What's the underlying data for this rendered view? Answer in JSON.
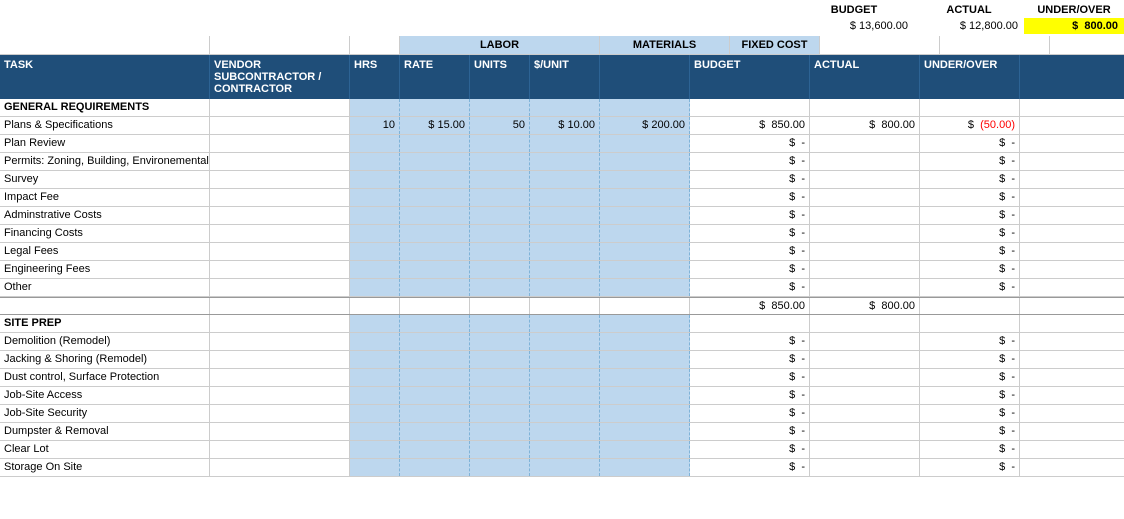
{
  "summary": {
    "budget_label": "BUDGET",
    "actual_label": "ACTUAL",
    "underover_label": "UNDER/OVER",
    "budget_value": "$ 13,600.00",
    "actual_value": "$ 12,800.00",
    "underover_value": "800.00"
  },
  "col_groups": {
    "labor_label": "LABOR",
    "materials_label": "MATERIALS",
    "fixed_cost_label": "FIXED COST"
  },
  "headers": {
    "task": "TASK",
    "vendor": "VENDOR\nSUBCONTRACTOR /\nCONTRACTOR",
    "hrs": "HRS",
    "rate": "RATE",
    "units": "UNITS",
    "sunit": "$/UNIT",
    "fixed": "",
    "budget": "BUDGET",
    "actual": "ACTUAL",
    "underover": "UNDER/OVER"
  },
  "sections": [
    {
      "name": "GENERAL REQUIREMENTS",
      "rows": [
        {
          "task": "Plans & Specifications",
          "vendor": "",
          "hrs": "10",
          "rate": "$ 15.00",
          "units": "50",
          "sunit": "$ 10.00",
          "fixed": "$ 200.00",
          "budget_dollar": "$",
          "budget_val": "850.00",
          "actual_dollar": "$",
          "actual_val": "800.00",
          "under_dollar": "$",
          "under_val": "(50.00)",
          "under_neg": true
        },
        {
          "task": "Plan Review",
          "vendor": "",
          "hrs": "",
          "rate": "",
          "units": "",
          "sunit": "",
          "fixed": "",
          "budget_dollar": "$",
          "budget_val": "-",
          "actual_dollar": "",
          "actual_val": "",
          "under_dollar": "$",
          "under_val": "-",
          "under_neg": false
        },
        {
          "task": "Permits: Zoning, Building, Environemental, Other",
          "vendor": "",
          "hrs": "",
          "rate": "",
          "units": "",
          "sunit": "",
          "fixed": "",
          "budget_dollar": "$",
          "budget_val": "-",
          "actual_dollar": "",
          "actual_val": "",
          "under_dollar": "$",
          "under_val": "-",
          "under_neg": false
        },
        {
          "task": "Survey",
          "vendor": "",
          "hrs": "",
          "rate": "",
          "units": "",
          "sunit": "",
          "fixed": "",
          "budget_dollar": "$",
          "budget_val": "-",
          "actual_dollar": "",
          "actual_val": "",
          "under_dollar": "$",
          "under_val": "-",
          "under_neg": false
        },
        {
          "task": "Impact Fee",
          "vendor": "",
          "hrs": "",
          "rate": "",
          "units": "",
          "sunit": "",
          "fixed": "",
          "budget_dollar": "$",
          "budget_val": "-",
          "actual_dollar": "",
          "actual_val": "",
          "under_dollar": "$",
          "under_val": "-",
          "under_neg": false
        },
        {
          "task": "Adminstrative Costs",
          "vendor": "",
          "hrs": "",
          "rate": "",
          "units": "",
          "sunit": "",
          "fixed": "",
          "budget_dollar": "$",
          "budget_val": "-",
          "actual_dollar": "",
          "actual_val": "",
          "under_dollar": "$",
          "under_val": "-",
          "under_neg": false
        },
        {
          "task": "Financing Costs",
          "vendor": "",
          "hrs": "",
          "rate": "",
          "units": "",
          "sunit": "",
          "fixed": "",
          "budget_dollar": "$",
          "budget_val": "-",
          "actual_dollar": "",
          "actual_val": "",
          "under_dollar": "$",
          "under_val": "-",
          "under_neg": false
        },
        {
          "task": "Legal Fees",
          "vendor": "",
          "hrs": "",
          "rate": "",
          "units": "",
          "sunit": "",
          "fixed": "",
          "budget_dollar": "$",
          "budget_val": "-",
          "actual_dollar": "",
          "actual_val": "",
          "under_dollar": "$",
          "under_val": "-",
          "under_neg": false
        },
        {
          "task": "Engineering Fees",
          "vendor": "",
          "hrs": "",
          "rate": "",
          "units": "",
          "sunit": "",
          "fixed": "",
          "budget_dollar": "$",
          "budget_val": "-",
          "actual_dollar": "",
          "actual_val": "",
          "under_dollar": "$",
          "under_val": "-",
          "under_neg": false
        },
        {
          "task": "Other",
          "vendor": "",
          "hrs": "",
          "rate": "",
          "units": "",
          "sunit": "",
          "fixed": "",
          "budget_dollar": "$",
          "budget_val": "-",
          "actual_dollar": "",
          "actual_val": "",
          "under_dollar": "$",
          "under_val": "-",
          "under_neg": false
        }
      ],
      "totals": {
        "budget_dollar": "$",
        "budget_val": "850.00",
        "actual_dollar": "$",
        "actual_val": "800.00"
      }
    },
    {
      "name": "SITE PREP",
      "rows": [
        {
          "task": "Demolition (Remodel)",
          "vendor": "",
          "hrs": "",
          "rate": "",
          "units": "",
          "sunit": "",
          "fixed": "",
          "budget_dollar": "$",
          "budget_val": "-",
          "actual_dollar": "",
          "actual_val": "",
          "under_dollar": "$",
          "under_val": "-",
          "under_neg": false
        },
        {
          "task": "Jacking & Shoring (Remodel)",
          "vendor": "",
          "hrs": "",
          "rate": "",
          "units": "",
          "sunit": "",
          "fixed": "",
          "budget_dollar": "$",
          "budget_val": "-",
          "actual_dollar": "",
          "actual_val": "",
          "under_dollar": "$",
          "under_val": "-",
          "under_neg": false
        },
        {
          "task": "Dust control, Surface Protection",
          "vendor": "",
          "hrs": "",
          "rate": "",
          "units": "",
          "sunit": "",
          "fixed": "",
          "budget_dollar": "$",
          "budget_val": "-",
          "actual_dollar": "",
          "actual_val": "",
          "under_dollar": "$",
          "under_val": "-",
          "under_neg": false
        },
        {
          "task": "Job-Site Access",
          "vendor": "",
          "hrs": "",
          "rate": "",
          "units": "",
          "sunit": "",
          "fixed": "",
          "budget_dollar": "$",
          "budget_val": "-",
          "actual_dollar": "",
          "actual_val": "",
          "under_dollar": "$",
          "under_val": "-",
          "under_neg": false
        },
        {
          "task": "Job-Site Security",
          "vendor": "",
          "hrs": "",
          "rate": "",
          "units": "",
          "sunit": "",
          "fixed": "",
          "budget_dollar": "$",
          "budget_val": "-",
          "actual_dollar": "",
          "actual_val": "",
          "under_dollar": "$",
          "under_val": "-",
          "under_neg": false
        },
        {
          "task": "Dumpster & Removal",
          "vendor": "",
          "hrs": "",
          "rate": "",
          "units": "",
          "sunit": "",
          "fixed": "",
          "budget_dollar": "$",
          "budget_val": "-",
          "actual_dollar": "",
          "actual_val": "",
          "under_dollar": "$",
          "under_val": "-",
          "under_neg": false
        },
        {
          "task": "Clear Lot",
          "vendor": "",
          "hrs": "",
          "rate": "",
          "units": "",
          "sunit": "",
          "fixed": "",
          "budget_dollar": "$",
          "budget_val": "-",
          "actual_dollar": "",
          "actual_val": "",
          "under_dollar": "$",
          "under_val": "-",
          "under_neg": false
        },
        {
          "task": "Storage On Site",
          "vendor": "",
          "hrs": "",
          "rate": "",
          "units": "",
          "sunit": "",
          "fixed": "",
          "budget_dollar": "$",
          "budget_val": "-",
          "actual_dollar": "",
          "actual_val": "",
          "under_dollar": "$",
          "under_val": "-",
          "under_neg": false
        }
      ]
    }
  ]
}
